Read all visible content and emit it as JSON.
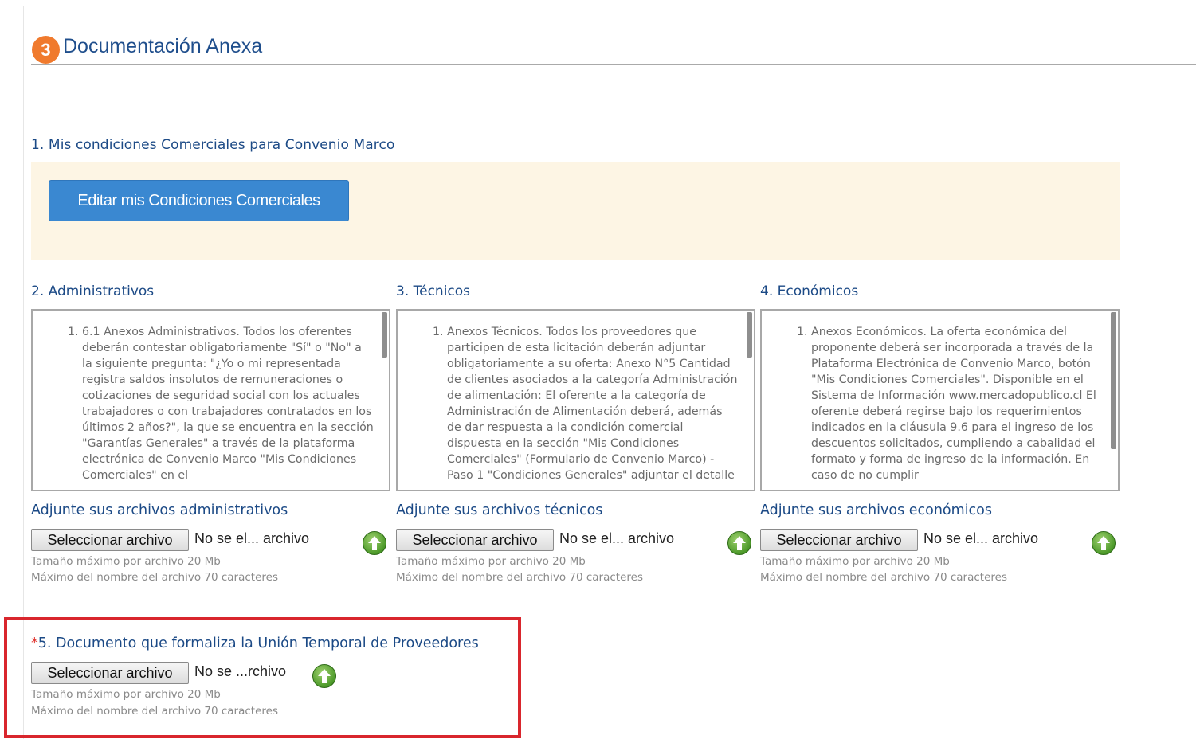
{
  "header": {
    "step_number": "3",
    "title": "Documentación Anexa"
  },
  "section1": {
    "title": "1. Mis condiciones Comerciales para Convenio Marco",
    "edit_button_label": "Editar mis Condiciones Comerciales"
  },
  "columns": [
    {
      "title": "2. Administrativos",
      "text": "6.1 Anexos Administrativos. Todos los oferentes deberán contestar obligatoriamente \"Sí\" o \"No\" a la siguiente pregunta: \"¿Yo o mi representada registra saldos insolutos de remuneraciones o cotizaciones de seguridad social con los actuales trabajadores o con trabajadores contratados en los últimos 2 años?\", la que se encuentra en la sección \"Garantías Generales\" a través de la plataforma electrónica de Convenio Marco \"Mis Condiciones Comerciales\" en el",
      "attach_title": "Adjunte sus archivos administrativos",
      "file_button": "Seleccionar archivo",
      "file_status": "No se el... archivo"
    },
    {
      "title": "3. Técnicos",
      "text": "Anexos Técnicos. Todos los proveedores que participen de esta licitación deberán adjuntar obligatoriamente a su oferta: Anexo N°5 Cantidad de clientes asociados a la categoría Administración de alimentación: El oferente a la categoría de Administración de Alimentación deberá, además de dar respuesta a la condición comercial dispuesta en la sección \"Mis Condiciones Comerciales\" (Formulario de Convenio Marco) - Paso 1 \"Condiciones Generales\" adjuntar el detalle",
      "attach_title": "Adjunte sus archivos técnicos",
      "file_button": "Seleccionar archivo",
      "file_status": "No se el... archivo"
    },
    {
      "title": "4. Económicos",
      "text": "Anexos Económicos. La oferta económica del proponente deberá ser incorporada a través de la Plataforma Electrónica de Convenio Marco, botón \"Mis Condiciones Comerciales\". Disponible en el Sistema de Información www.mercadopublico.cl El oferente deberá regirse bajo los requerimientos indicados en la cláusula 9.6 para el ingreso de los descuentos solicitados, cumpliendo a cabalidad el formato y forma de ingreso de la información. En caso de no cumplir",
      "attach_title": "Adjunte sus archivos económicos",
      "file_button": "Seleccionar archivo",
      "file_status": "No se el... archivo"
    }
  ],
  "limits": {
    "size": "Tamaño máximo por archivo 20 Mb",
    "name": "Máximo del nombre del archivo 70 caracteres"
  },
  "section5": {
    "required_mark": "*",
    "title": "5. Documento que formaliza la Unión Temporal de Proveedores",
    "file_button": "Seleccionar archivo",
    "file_status": "No se ...rchivo"
  },
  "colors": {
    "accent_title": "#1c4a86",
    "step_badge": "#f07a2d",
    "edit_button": "#3a88d1",
    "panel_bg": "#fdf5e4",
    "highlight_border": "#d9262d",
    "upload_icon": "#4d9a2a"
  },
  "icons": {
    "step": "step-number-badge",
    "upload": "upload-arrow-icon"
  }
}
